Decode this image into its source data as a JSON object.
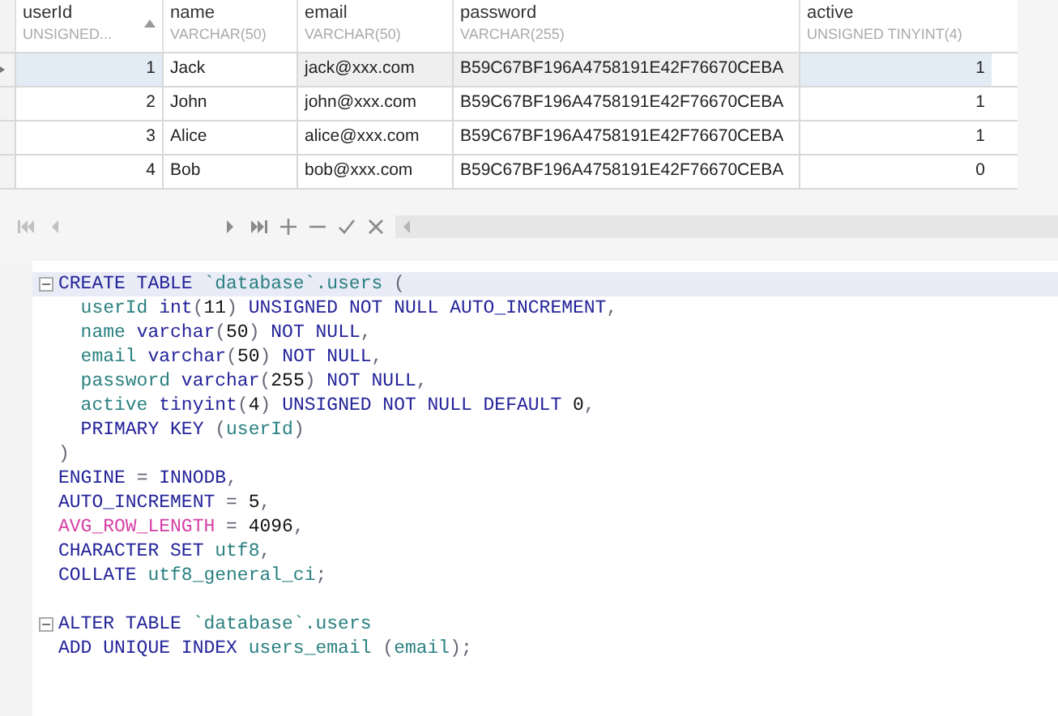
{
  "grid": {
    "columns": [
      {
        "name": "userId",
        "type": "UNSIGNED...",
        "sorted": true,
        "kind": "number"
      },
      {
        "name": "name",
        "type": "VARCHAR(50)",
        "sorted": false,
        "kind": "text"
      },
      {
        "name": "email",
        "type": "VARCHAR(50)",
        "sorted": false,
        "kind": "text"
      },
      {
        "name": "password",
        "type": "VARCHAR(255)",
        "sorted": false,
        "kind": "text"
      },
      {
        "name": "active",
        "type": "UNSIGNED TINYINT(4)",
        "sorted": false,
        "kind": "number"
      }
    ],
    "rows": [
      {
        "selected": true,
        "cells": [
          "1",
          "Jack",
          "jack@xxx.com",
          "B59C67BF196A4758191E42F76670CEBA",
          "1"
        ]
      },
      {
        "selected": false,
        "cells": [
          "2",
          "John",
          "john@xxx.com",
          "B59C67BF196A4758191E42F76670CEBA",
          "1"
        ]
      },
      {
        "selected": false,
        "cells": [
          "3",
          "Alice",
          "alice@xxx.com",
          "B59C67BF196A4758191E42F76670CEBA",
          "1"
        ]
      },
      {
        "selected": false,
        "cells": [
          "4",
          "Bob",
          "bob@xxx.com",
          "B59C67BF196A4758191E42F76670CEBA",
          "0"
        ]
      }
    ]
  },
  "navigator": [
    {
      "kind": "first",
      "disabled": true
    },
    {
      "kind": "prev",
      "disabled": true
    },
    {
      "kind": "next",
      "disabled": false
    },
    {
      "kind": "last",
      "disabled": false
    },
    {
      "kind": "add",
      "disabled": false
    },
    {
      "kind": "delete",
      "disabled": false
    },
    {
      "kind": "post",
      "disabled": false
    },
    {
      "kind": "cancel",
      "disabled": false
    }
  ],
  "editor": {
    "lines": [
      {
        "fold": true,
        "current": true,
        "tokens": [
          {
            "kind": "keyword",
            "text": "CREATE TABLE "
          },
          {
            "kind": "identifier",
            "text": "`database`.users"
          },
          {
            "kind": "punctuation",
            "text": " ("
          }
        ]
      },
      {
        "fold": false,
        "current": false,
        "tokens": [
          {
            "kind": "identifier",
            "text": "  userId "
          },
          {
            "kind": "keyword",
            "text": "int"
          },
          {
            "kind": "punctuation",
            "text": "("
          },
          {
            "kind": "number",
            "text": "11"
          },
          {
            "kind": "punctuation",
            "text": ") "
          },
          {
            "kind": "keyword",
            "text": "UNSIGNED NOT NULL AUTO_INCREMENT"
          },
          {
            "kind": "punctuation",
            "text": ","
          }
        ]
      },
      {
        "fold": false,
        "current": false,
        "tokens": [
          {
            "kind": "identifier",
            "text": "  name "
          },
          {
            "kind": "keyword",
            "text": "varchar"
          },
          {
            "kind": "punctuation",
            "text": "("
          },
          {
            "kind": "number",
            "text": "50"
          },
          {
            "kind": "punctuation",
            "text": ") "
          },
          {
            "kind": "keyword",
            "text": "NOT NULL"
          },
          {
            "kind": "punctuation",
            "text": ","
          }
        ]
      },
      {
        "fold": false,
        "current": false,
        "tokens": [
          {
            "kind": "identifier",
            "text": "  email "
          },
          {
            "kind": "keyword",
            "text": "varchar"
          },
          {
            "kind": "punctuation",
            "text": "("
          },
          {
            "kind": "number",
            "text": "50"
          },
          {
            "kind": "punctuation",
            "text": ") "
          },
          {
            "kind": "keyword",
            "text": "NOT NULL"
          },
          {
            "kind": "punctuation",
            "text": ","
          }
        ]
      },
      {
        "fold": false,
        "current": false,
        "tokens": [
          {
            "kind": "identifier",
            "text": "  password "
          },
          {
            "kind": "keyword",
            "text": "varchar"
          },
          {
            "kind": "punctuation",
            "text": "("
          },
          {
            "kind": "number",
            "text": "255"
          },
          {
            "kind": "punctuation",
            "text": ") "
          },
          {
            "kind": "keyword",
            "text": "NOT NULL"
          },
          {
            "kind": "punctuation",
            "text": ","
          }
        ]
      },
      {
        "fold": false,
        "current": false,
        "tokens": [
          {
            "kind": "identifier",
            "text": "  active "
          },
          {
            "kind": "keyword",
            "text": "tinyint"
          },
          {
            "kind": "punctuation",
            "text": "("
          },
          {
            "kind": "number",
            "text": "4"
          },
          {
            "kind": "punctuation",
            "text": ") "
          },
          {
            "kind": "keyword",
            "text": "UNSIGNED NOT NULL DEFAULT "
          },
          {
            "kind": "number",
            "text": "0"
          },
          {
            "kind": "punctuation",
            "text": ","
          }
        ]
      },
      {
        "fold": false,
        "current": false,
        "tokens": [
          {
            "kind": "keyword",
            "text": "  PRIMARY KEY "
          },
          {
            "kind": "punctuation",
            "text": "("
          },
          {
            "kind": "identifier",
            "text": "userId"
          },
          {
            "kind": "punctuation",
            "text": ")"
          }
        ]
      },
      {
        "fold": false,
        "current": false,
        "tokens": [
          {
            "kind": "punctuation",
            "text": ")"
          }
        ]
      },
      {
        "fold": false,
        "current": false,
        "tokens": [
          {
            "kind": "keyword",
            "text": "ENGINE"
          },
          {
            "kind": "punctuation",
            "text": " = "
          },
          {
            "kind": "keyword",
            "text": "INNODB"
          },
          {
            "kind": "punctuation",
            "text": ","
          }
        ]
      },
      {
        "fold": false,
        "current": false,
        "tokens": [
          {
            "kind": "keyword",
            "text": "AUTO_INCREMENT"
          },
          {
            "kind": "punctuation",
            "text": " = "
          },
          {
            "kind": "number",
            "text": "5"
          },
          {
            "kind": "punctuation",
            "text": ","
          }
        ]
      },
      {
        "fold": false,
        "current": false,
        "tokens": [
          {
            "kind": "option",
            "text": "AVG_ROW_LENGTH"
          },
          {
            "kind": "punctuation",
            "text": " = "
          },
          {
            "kind": "number",
            "text": "4096"
          },
          {
            "kind": "punctuation",
            "text": ","
          }
        ]
      },
      {
        "fold": false,
        "current": false,
        "tokens": [
          {
            "kind": "keyword",
            "text": "CHARACTER SET "
          },
          {
            "kind": "identifier",
            "text": "utf8"
          },
          {
            "kind": "punctuation",
            "text": ","
          }
        ]
      },
      {
        "fold": false,
        "current": false,
        "tokens": [
          {
            "kind": "keyword",
            "text": "COLLATE "
          },
          {
            "kind": "identifier",
            "text": "utf8_general_ci"
          },
          {
            "kind": "punctuation",
            "text": ";"
          }
        ]
      },
      {
        "fold": false,
        "current": false
      },
      {
        "fold": true,
        "current": false,
        "tokens": [
          {
            "kind": "keyword",
            "text": "ALTER TABLE "
          },
          {
            "kind": "identifier",
            "text": "`database`.users"
          }
        ]
      },
      {
        "fold": false,
        "current": false,
        "tokens": [
          {
            "kind": "keyword",
            "text": "ADD UNIQUE INDEX "
          },
          {
            "kind": "identifier",
            "text": "users_email"
          },
          {
            "kind": "punctuation",
            "text": " ("
          },
          {
            "kind": "identifier",
            "text": "email"
          },
          {
            "kind": "punctuation",
            "text": ");"
          }
        ]
      }
    ]
  }
}
